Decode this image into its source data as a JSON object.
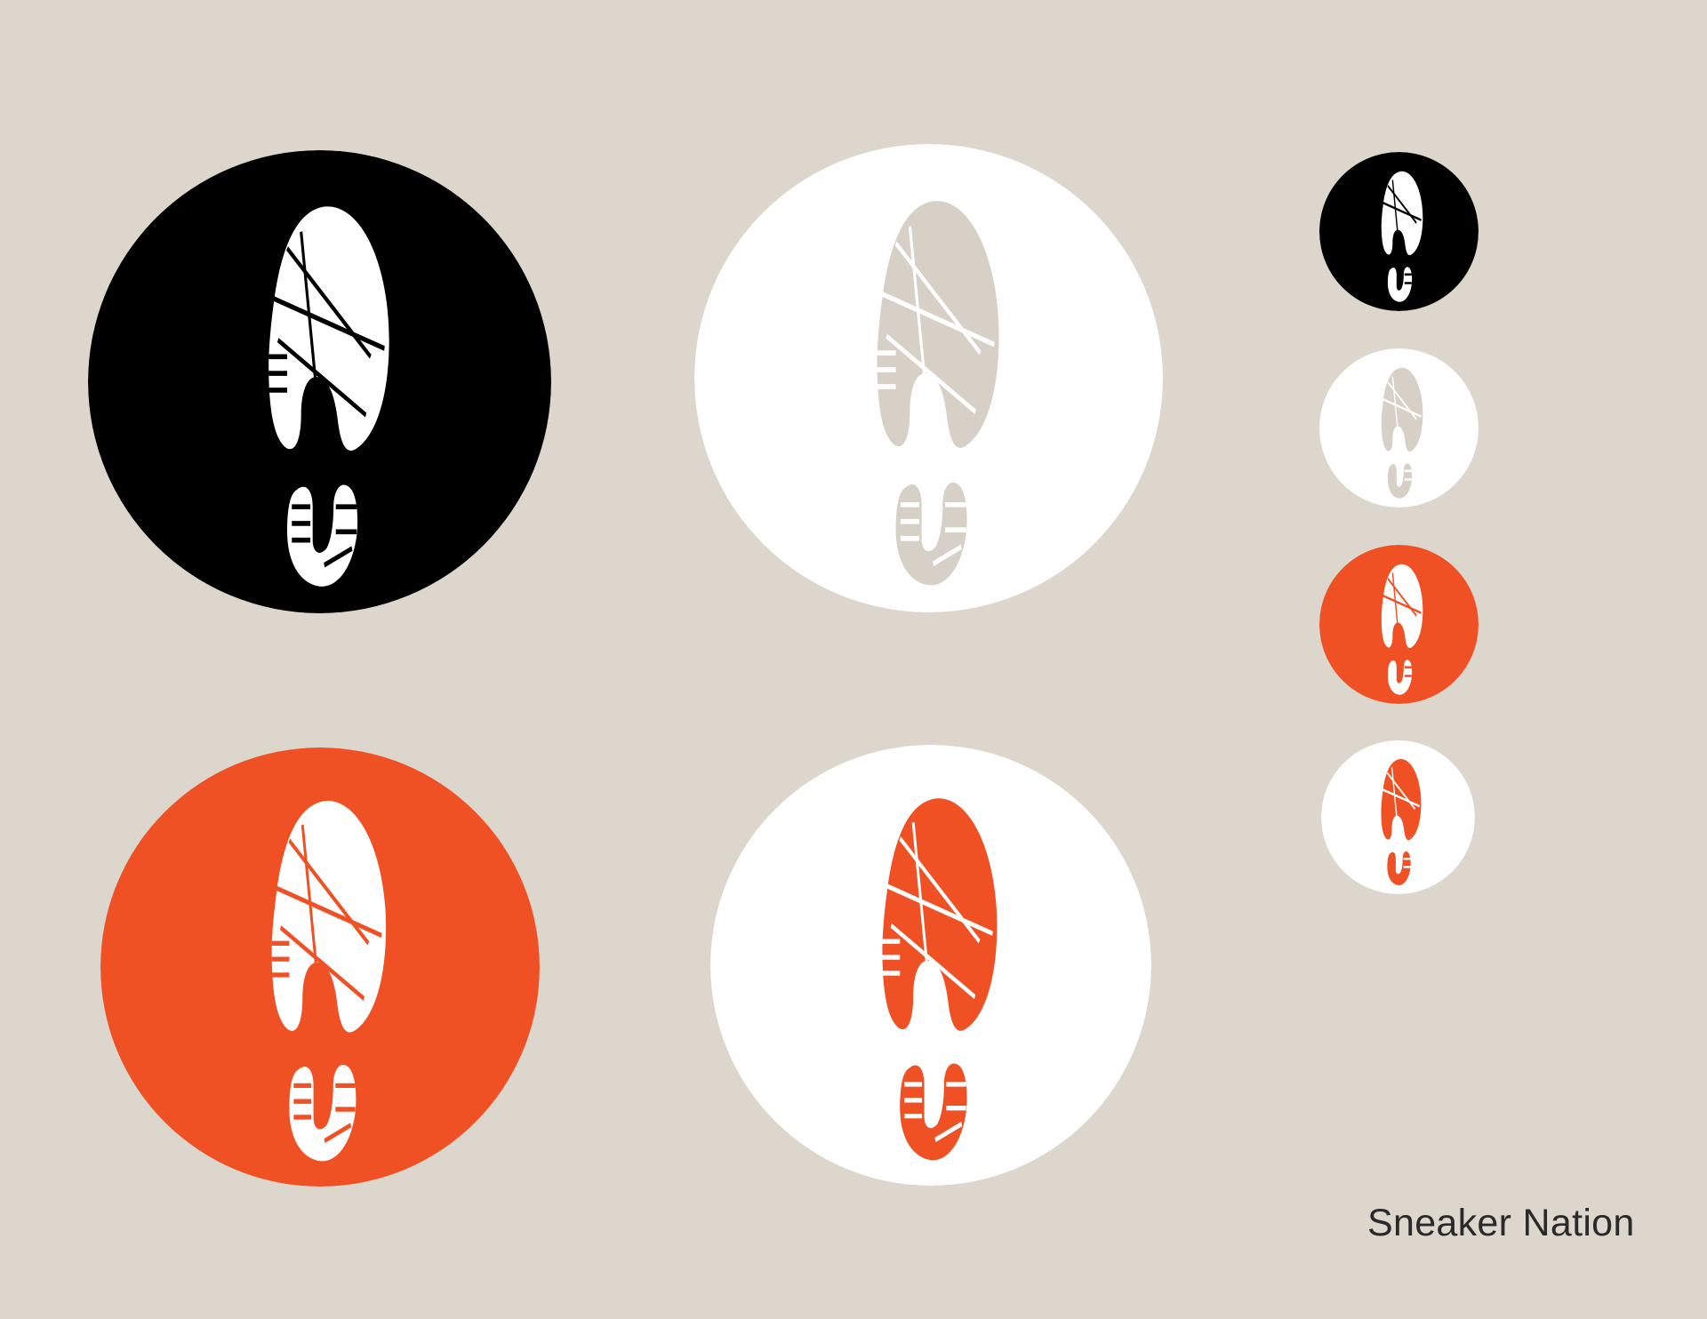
{
  "brand": {
    "name": "Sneaker Nation"
  },
  "colors": {
    "background": "#dcd6cc",
    "black": "#000000",
    "white": "#ffffff",
    "orange": "#ef5124",
    "tan": "#d6d0c6"
  },
  "logo_variants": [
    {
      "id": "black-large",
      "background": "#000000",
      "print": "#ffffff",
      "icon": "shoeprint-icon"
    },
    {
      "id": "white-tan-large",
      "background": "#ffffff",
      "print": "#d6d0c6",
      "icon": "shoeprint-icon"
    },
    {
      "id": "orange-large",
      "background": "#ef5124",
      "print": "#ffffff",
      "icon": "shoeprint-icon"
    },
    {
      "id": "white-orange-large",
      "background": "#ffffff",
      "print": "#ef5124",
      "icon": "shoeprint-icon"
    },
    {
      "id": "black-small",
      "background": "#000000",
      "print": "#ffffff",
      "icon": "shoeprint-icon"
    },
    {
      "id": "white-tan-small",
      "background": "#ffffff",
      "print": "#d6d0c6",
      "icon": "shoeprint-icon"
    },
    {
      "id": "orange-small",
      "background": "#ef5124",
      "print": "#ffffff",
      "icon": "shoeprint-icon"
    },
    {
      "id": "white-orange-small",
      "background": "#ffffff",
      "print": "#ef5124",
      "icon": "shoeprint-icon"
    }
  ]
}
